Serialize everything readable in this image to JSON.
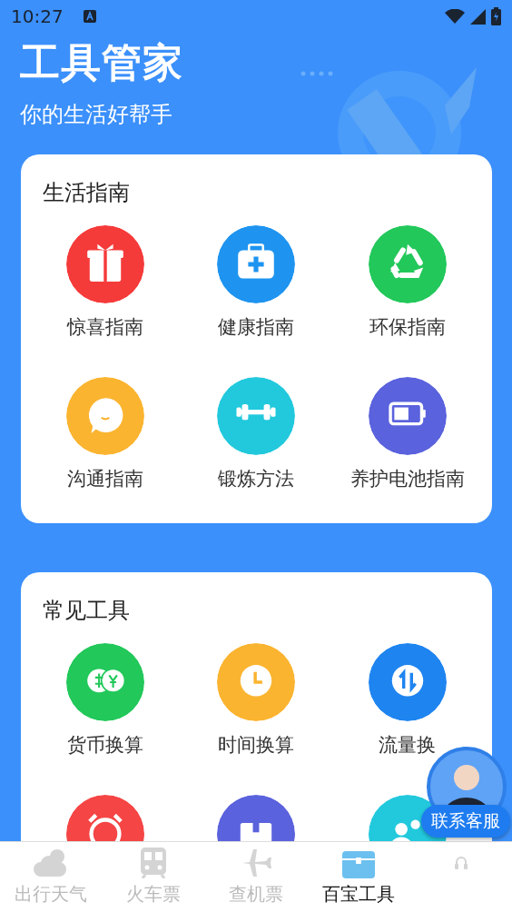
{
  "status_bar": {
    "time": "10:27"
  },
  "header": {
    "title": "工具管家",
    "subtitle": "你的生活好帮手"
  },
  "sections": [
    {
      "title": "生活指南",
      "items": [
        {
          "kind": "gift",
          "label": "惊喜指南",
          "color": "#f53a3a"
        },
        {
          "kind": "medkit",
          "label": "健康指南",
          "color": "#1e94f0"
        },
        {
          "kind": "recycle",
          "label": "环保指南",
          "color": "#22c85a"
        },
        {
          "kind": "chat",
          "label": "沟通指南",
          "color": "#fbb430"
        },
        {
          "kind": "dumbbell",
          "label": "锻炼方法",
          "color": "#22c9dd"
        },
        {
          "kind": "battery",
          "label": "养护电池指南",
          "color": "#5a62dd"
        }
      ]
    },
    {
      "title": "常见工具",
      "items": [
        {
          "kind": "money",
          "label": "货币换算",
          "color": "#22c85a"
        },
        {
          "kind": "clock",
          "label": "时间换算",
          "color": "#fbb430"
        },
        {
          "kind": "transfer",
          "label": "流量换",
          "color": "#1e84f0"
        },
        {
          "kind": "alarm",
          "color": "#f54545"
        },
        {
          "kind": "card",
          "color": "#5a62dd"
        },
        {
          "kind": "people",
          "color": "#22c9dd"
        }
      ]
    }
  ],
  "service": {
    "label": "联系客服"
  },
  "tabs": [
    {
      "kind": "cloud",
      "label": "出行天气",
      "selected": false
    },
    {
      "kind": "train",
      "label": "火车票",
      "selected": false
    },
    {
      "kind": "plane",
      "label": "查机票",
      "selected": false
    },
    {
      "kind": "chest",
      "label": "百宝工具",
      "selected": true
    },
    {
      "kind": "headset",
      "selected": false
    }
  ]
}
